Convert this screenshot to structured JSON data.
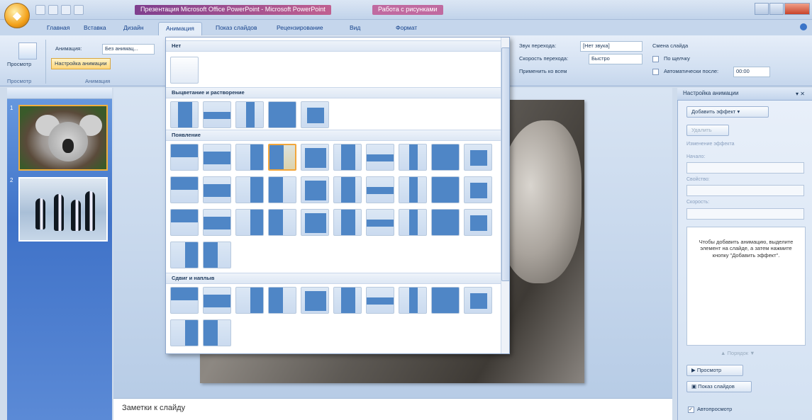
{
  "window": {
    "title": "Презентация Microsoft Office PowerPoint - Microsoft PowerPoint",
    "context_title": "Работа с рисунками"
  },
  "tabs": [
    "Главная",
    "Вставка",
    "Дизайн",
    "Анимация",
    "Показ слайдов",
    "Рецензирование",
    "Вид",
    "Формат"
  ],
  "active_tab": "Анимация",
  "ribbon": {
    "preview_label": "Просмотр",
    "animation_label": "Анимация:",
    "animation_value": "Без анимац...",
    "custom_animation_btn": "Настройка анимации",
    "group_preview": "Просмотр",
    "group_animation": "Анимация",
    "sound_label": "Звук перехода:",
    "sound_value": "[Нет звука]",
    "speed_label": "Скорость перехода:",
    "speed_value": "Быстро",
    "apply_all": "Применить ко всем",
    "advance_label": "Смена слайда",
    "on_click": "По щелчку",
    "auto_after": "Автоматически после:",
    "auto_time": "00:00"
  },
  "gallery": {
    "none_header": "Нет",
    "sec_fade": "Выцветание и растворение",
    "sec_wipe": "Появление",
    "sec_push": "Сдвиг и наплыв"
  },
  "task_pane": {
    "title": "Настройка анимации",
    "add_effect": "Добавить эффект",
    "remove": "Удалить",
    "change_effect_label": "Изменение эффекта",
    "start_label": "Начало:",
    "property_label": "Свойство:",
    "speed_label": "Скорость:",
    "hint": "Чтобы добавить анимацию, выделите элемент на слайде, а затем нажмите кнопку \"Добавить эффект\".",
    "reorder_label": "Порядок",
    "play": "Просмотр",
    "slide_show": "Показ слайдов",
    "autopreview": "Автопросмотр"
  },
  "slides": {
    "num1": "1",
    "num2": "2"
  },
  "notes": {
    "placeholder": "Заметки к слайду"
  },
  "colors": {
    "accent": "#f2a63b",
    "ribbon": "#dbe6f4",
    "pane_blue": "#4f7fcf"
  }
}
